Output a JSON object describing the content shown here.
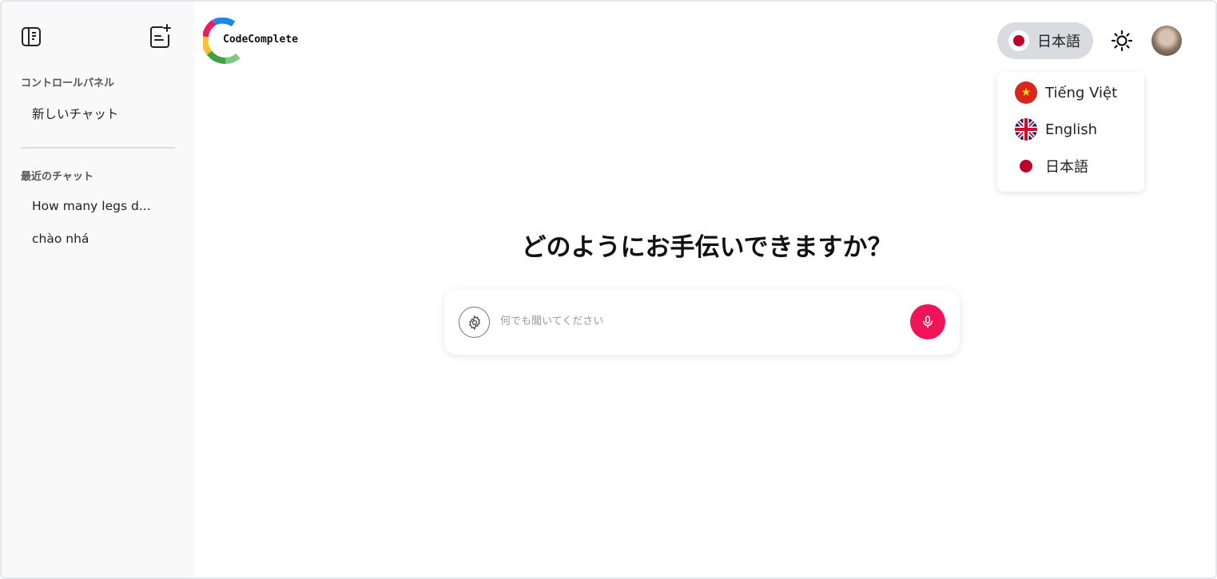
{
  "app": {
    "logo_text": "CodeComplete"
  },
  "sidebar": {
    "control_panel_heading": "コントロールパネル",
    "new_chat_label": "新しいチャット",
    "recent_heading": "最近のチャット",
    "recent_chats": [
      {
        "label": "How many legs d..."
      },
      {
        "label": "chào nhá"
      }
    ]
  },
  "header": {
    "language_current": "日本語",
    "language_options": [
      {
        "label": "Tiếng Việt",
        "flag": "vietnam-flag-icon"
      },
      {
        "label": "English",
        "flag": "uk-flag-icon"
      },
      {
        "label": "日本語",
        "flag": "japan-flag-icon"
      }
    ],
    "theme_icon": "sun-icon"
  },
  "main": {
    "headline": "どのようにお手伝いできますか？",
    "input_placeholder": "何でも聞いてください",
    "input_value": ""
  },
  "colors": {
    "accent": "#f0145a",
    "sidebar_bg": "#f9f9f9",
    "lang_button_bg": "#d8dbe0"
  }
}
